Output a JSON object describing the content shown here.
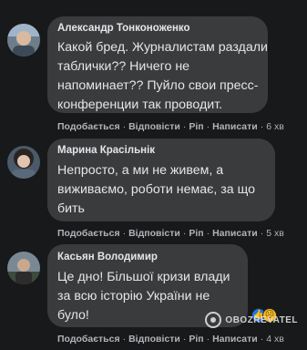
{
  "comments": [
    {
      "author": "Александр Тонконоженко",
      "lines": [
        "Какой бред. Журналистам раздали",
        "таблички?? Ничего не",
        "напоминает?? Пуйло свои пресс-",
        "конференции так проводит."
      ],
      "actions": {
        "like": "Подобається",
        "reply": "Відповісти",
        "share": "Рiп",
        "edit": "Написати"
      },
      "time": "6 хв"
    },
    {
      "author": "Марина Красільнік",
      "lines": [
        "Непросто, а ми не живем, а",
        "виживаємо, роботи немає, за що",
        "бить"
      ],
      "actions": {
        "like": "Подобається",
        "reply": "Відповісти",
        "share": "Рiп",
        "edit": "Написати"
      },
      "time": "5 хв"
    },
    {
      "author": "Касьян Володимир",
      "lines": [
        "Це дно! Більшої кризи влади",
        "за всю історію України не",
        "було!"
      ],
      "actions": {
        "like": "Подобається",
        "reply": "Відповісти",
        "share": "Рiп",
        "edit": "Написати"
      },
      "time": "4 хв",
      "reactions": {
        "count": "2",
        "icons": [
          "like-icon",
          "sad-icon"
        ]
      }
    }
  ],
  "watermark": {
    "text": "OBOZREVATEL"
  },
  "colors": {
    "background": "#18191a",
    "bubble": "#3a3b3c",
    "text": "#e4e6eb",
    "meta": "#b0b3b8"
  }
}
